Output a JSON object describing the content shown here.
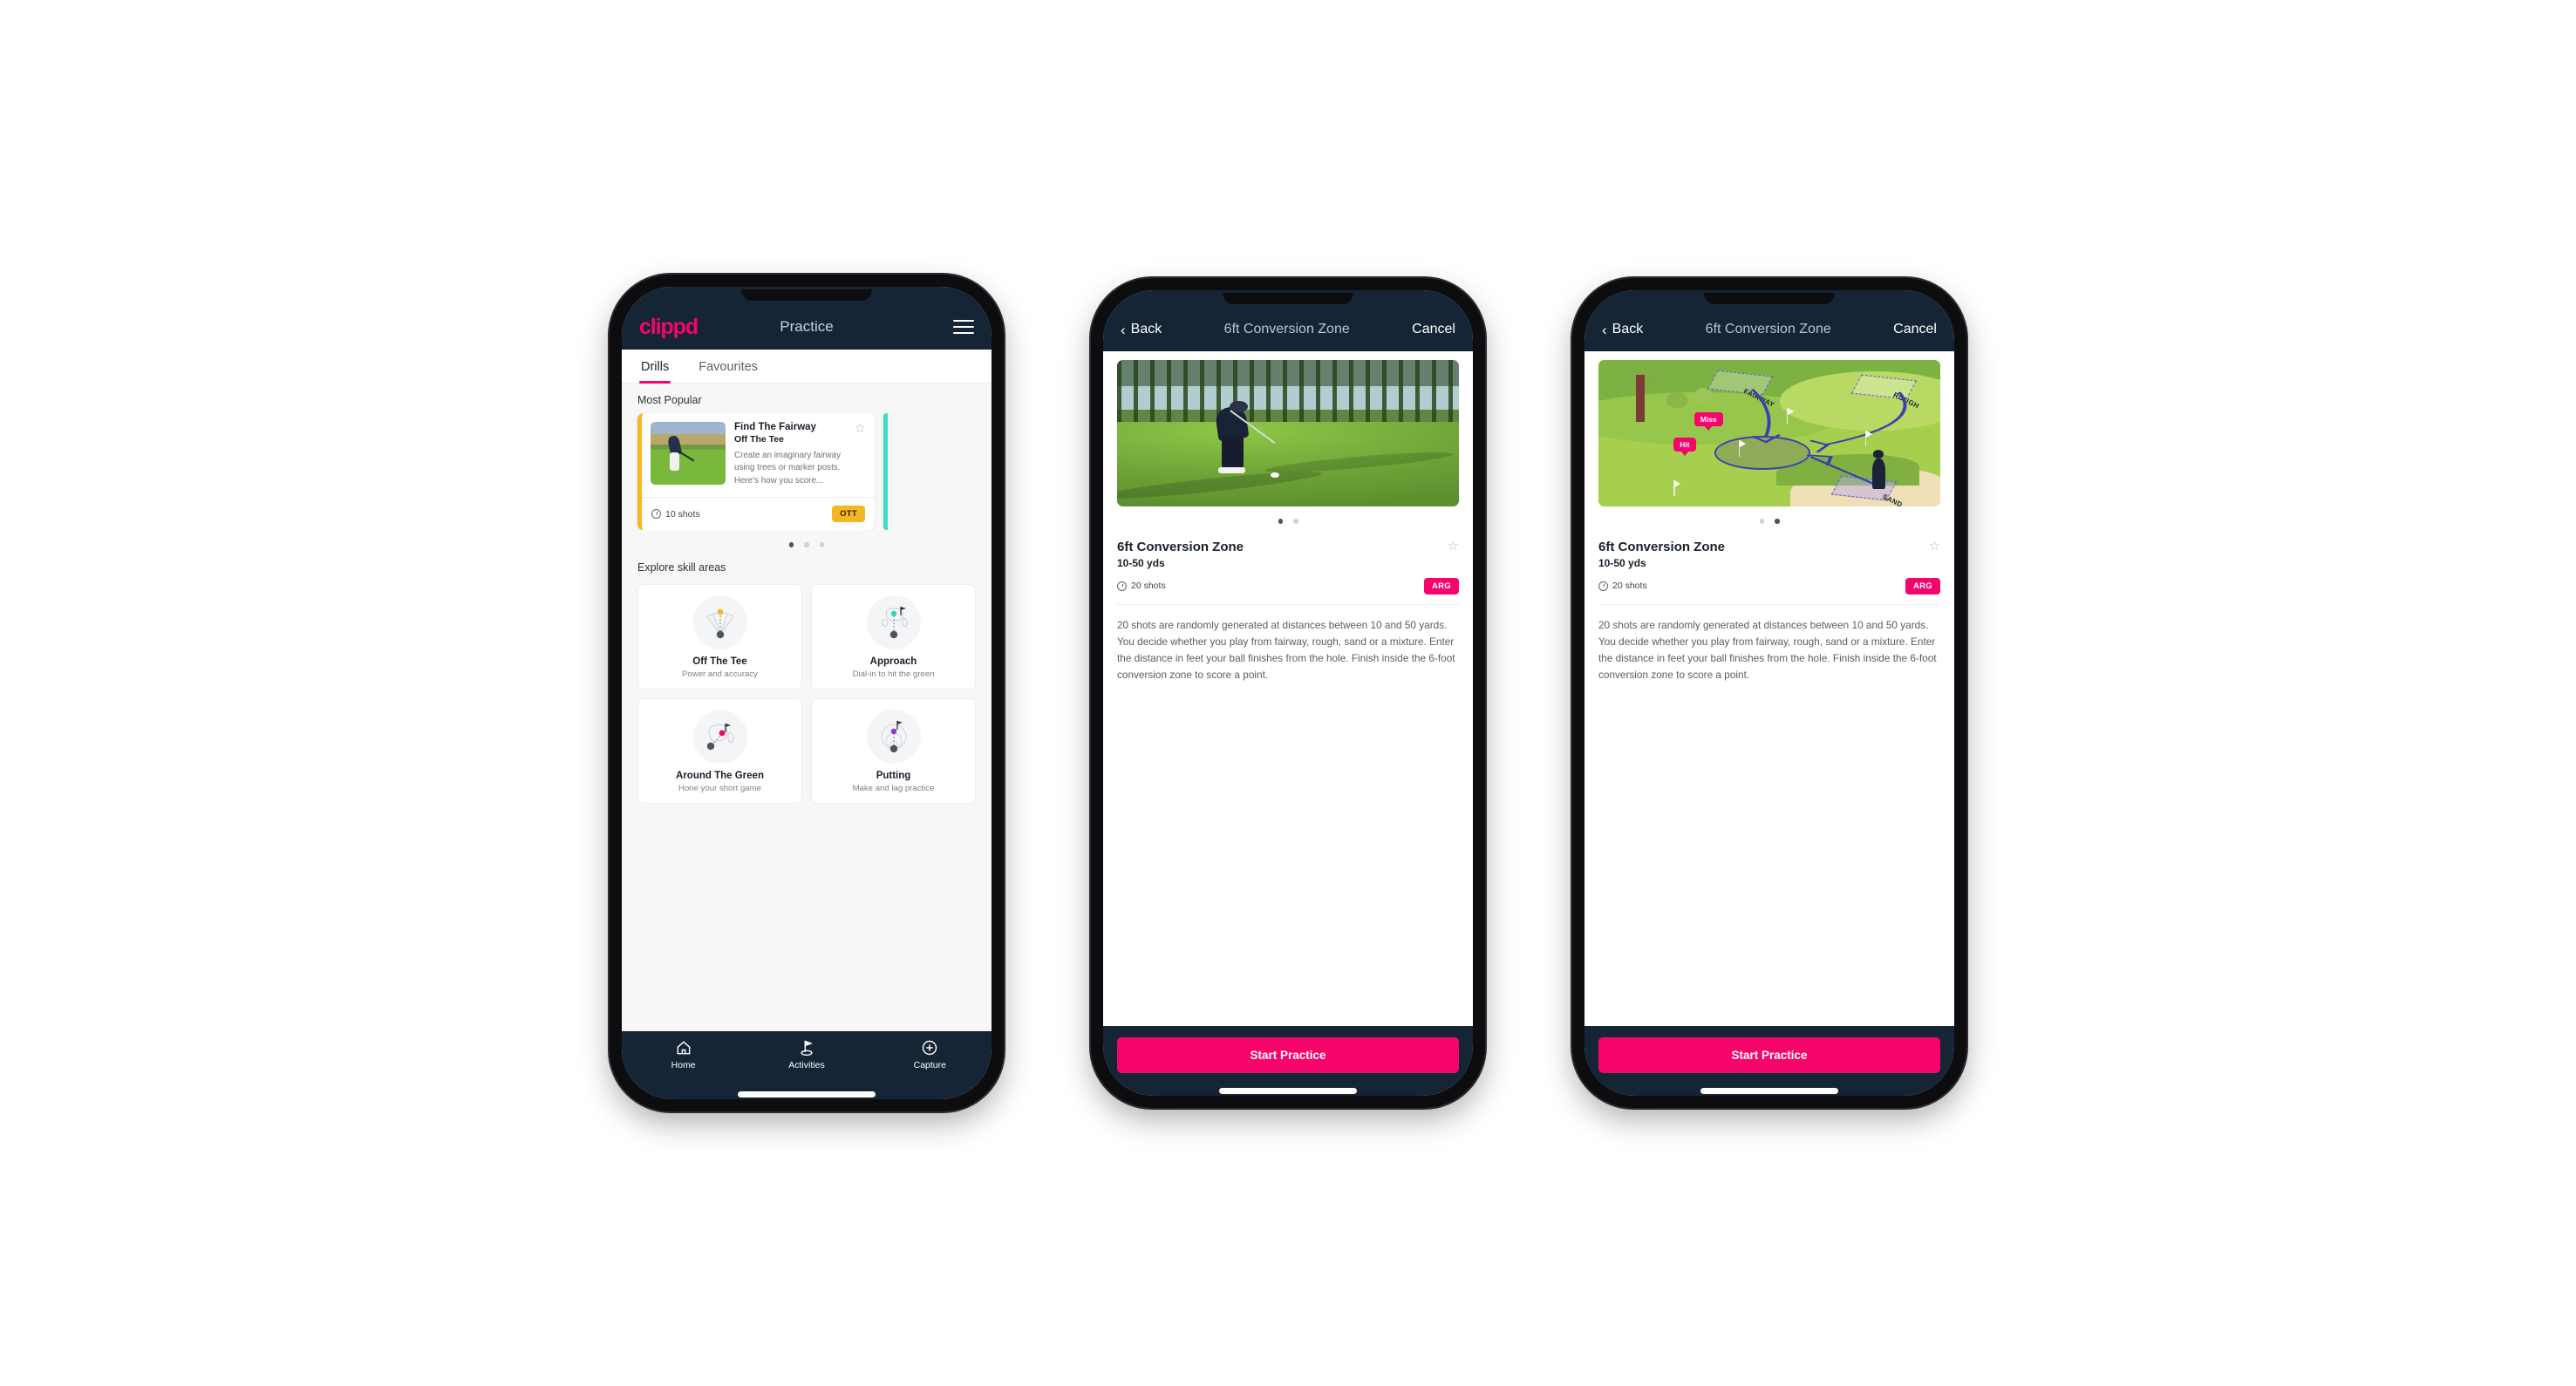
{
  "brand": {
    "name": "clippd",
    "accent": "#f5056b",
    "dark_header": "#152536"
  },
  "phone1": {
    "appbar": {
      "logo": "clippd",
      "title": "Practice",
      "menu_icon": "hamburger-icon"
    },
    "tabs": [
      {
        "label": "Drills",
        "active": true
      },
      {
        "label": "Favourites",
        "active": false
      }
    ],
    "most_popular_label": "Most Popular",
    "drill_card": {
      "title": "Find The Fairway",
      "subtitle": "Off The Tee",
      "description": "Create an imaginary fairway using trees or marker posts. Here's how you score...",
      "shots": "10 shots",
      "badge": "OTT",
      "badge_color": "#f5b625",
      "accent_color": "#f5b625",
      "star_icon": "star-outline-icon"
    },
    "carousel_dots": {
      "count": 3,
      "active_index": 0
    },
    "explore_label": "Explore skill areas",
    "skills": [
      {
        "name": "Off The Tee",
        "desc": "Power and accuracy",
        "icon": "tee-fan-icon",
        "dot_color": "#f5b625"
      },
      {
        "name": "Approach",
        "desc": "Dial-in to hit the green",
        "icon": "approach-green-icon",
        "dot_color": "#2ed3b7"
      },
      {
        "name": "Around The Green",
        "desc": "Hone your short game",
        "icon": "around-green-icon",
        "dot_color": "#f5056b"
      },
      {
        "name": "Putting",
        "desc": "Make and lag practice",
        "icon": "putting-rings-icon",
        "dot_color": "#9b30d9"
      }
    ],
    "tabbar": [
      {
        "label": "Home",
        "icon": "home-icon",
        "active": false
      },
      {
        "label": "Activities",
        "icon": "golf-flag-icon",
        "active": true
      },
      {
        "label": "Capture",
        "icon": "plus-circle-icon",
        "active": false
      }
    ]
  },
  "phone2": {
    "navbar": {
      "back": "Back",
      "title": "6ft Conversion Zone",
      "cancel": "Cancel",
      "back_icon": "chevron-left-icon"
    },
    "media": {
      "type": "photo",
      "alt": "golfer-chipping-photo"
    },
    "dots": {
      "count": 2,
      "active_index": 0
    },
    "title": "6ft Conversion Zone",
    "yards": "10-50 yds",
    "shots": "20 shots",
    "badge": "ARG",
    "badge_color": "#f5056b",
    "star_icon": "star-outline-icon",
    "description": "20 shots are randomly generated at distances between 10 and 50 yards. You decide whether you play from fairway, rough, sand or a mixture. Enter the distance in feet your ball finishes from the hole. Finish inside the 6-foot conversion zone to score a point.",
    "cta": "Start Practice"
  },
  "phone3": {
    "navbar": {
      "back": "Back",
      "title": "6ft Conversion Zone",
      "cancel": "Cancel",
      "back_icon": "chevron-left-icon"
    },
    "media": {
      "type": "illustration",
      "alt": "golf-hole-diagram",
      "zones": [
        "FAIRWAY",
        "ROUGH",
        "SAND"
      ],
      "callouts": [
        "Miss",
        "Hit"
      ]
    },
    "dots": {
      "count": 2,
      "active_index": 1
    },
    "title": "6ft Conversion Zone",
    "yards": "10-50 yds",
    "shots": "20 shots",
    "badge": "ARG",
    "badge_color": "#f5056b",
    "star_icon": "star-outline-icon",
    "description": "20 shots are randomly generated at distances between 10 and 50 yards. You decide whether you play from fairway, rough, sand or a mixture. Enter the distance in feet your ball finishes from the hole. Finish inside the 6-foot conversion zone to score a point.",
    "cta": "Start Practice"
  }
}
